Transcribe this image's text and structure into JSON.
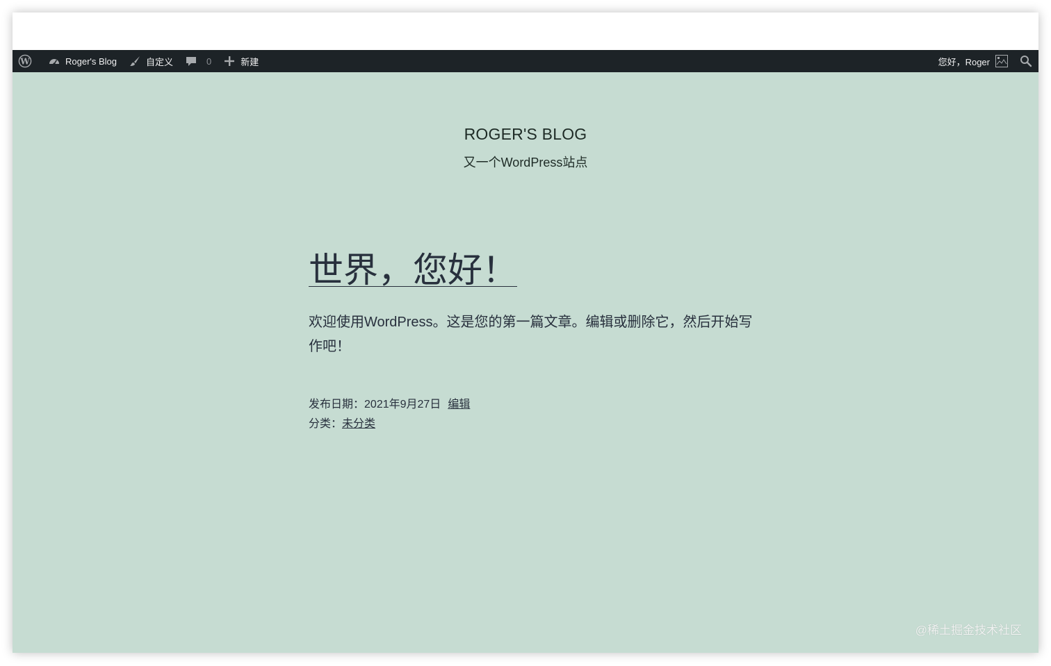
{
  "admin_bar": {
    "site_name": "Roger's Blog",
    "customize_label": "自定义",
    "comments_count": "0",
    "new_label": "新建",
    "greeting": "您好，Roger"
  },
  "site": {
    "title": "ROGER'S BLOG",
    "description": "又一个WordPress站点"
  },
  "post": {
    "title": "世界，您好！",
    "body": "欢迎使用WordPress。这是您的第一篇文章。编辑或删除它，然后开始写作吧！",
    "date_label": "发布日期：",
    "date": "2021年9月27日",
    "edit_link": "编辑",
    "category_label": "分类：",
    "category": "未分类"
  },
  "watermark": "@稀土掘金技术社区",
  "colors": {
    "admin_bar_bg": "#1d2327",
    "page_bg": "#c6dcd2",
    "text": "#28303d"
  }
}
